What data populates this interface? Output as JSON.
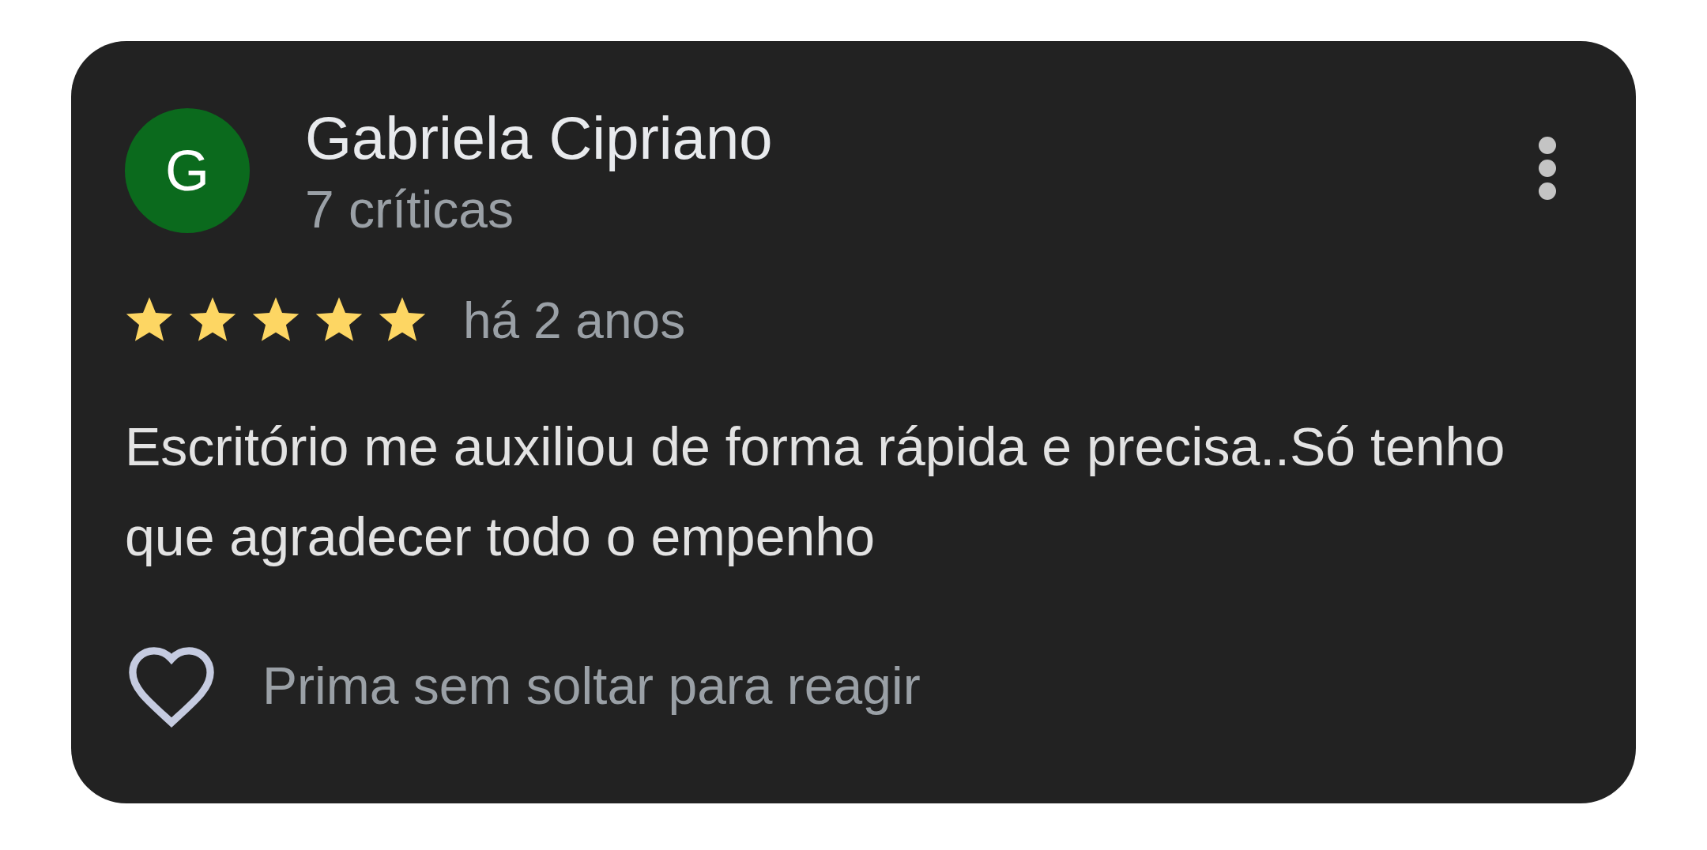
{
  "review": {
    "avatar_letter": "G",
    "author": "Gabriela Cipriano",
    "review_count": "7 críticas",
    "stars": 5,
    "time": "há 2 anos",
    "text": "Escritório me auxiliou de forma rápida e precisa..Só tenho que agradecer todo o empenho",
    "reaction_hint": "Prima sem soltar para reagir",
    "liked": false
  }
}
